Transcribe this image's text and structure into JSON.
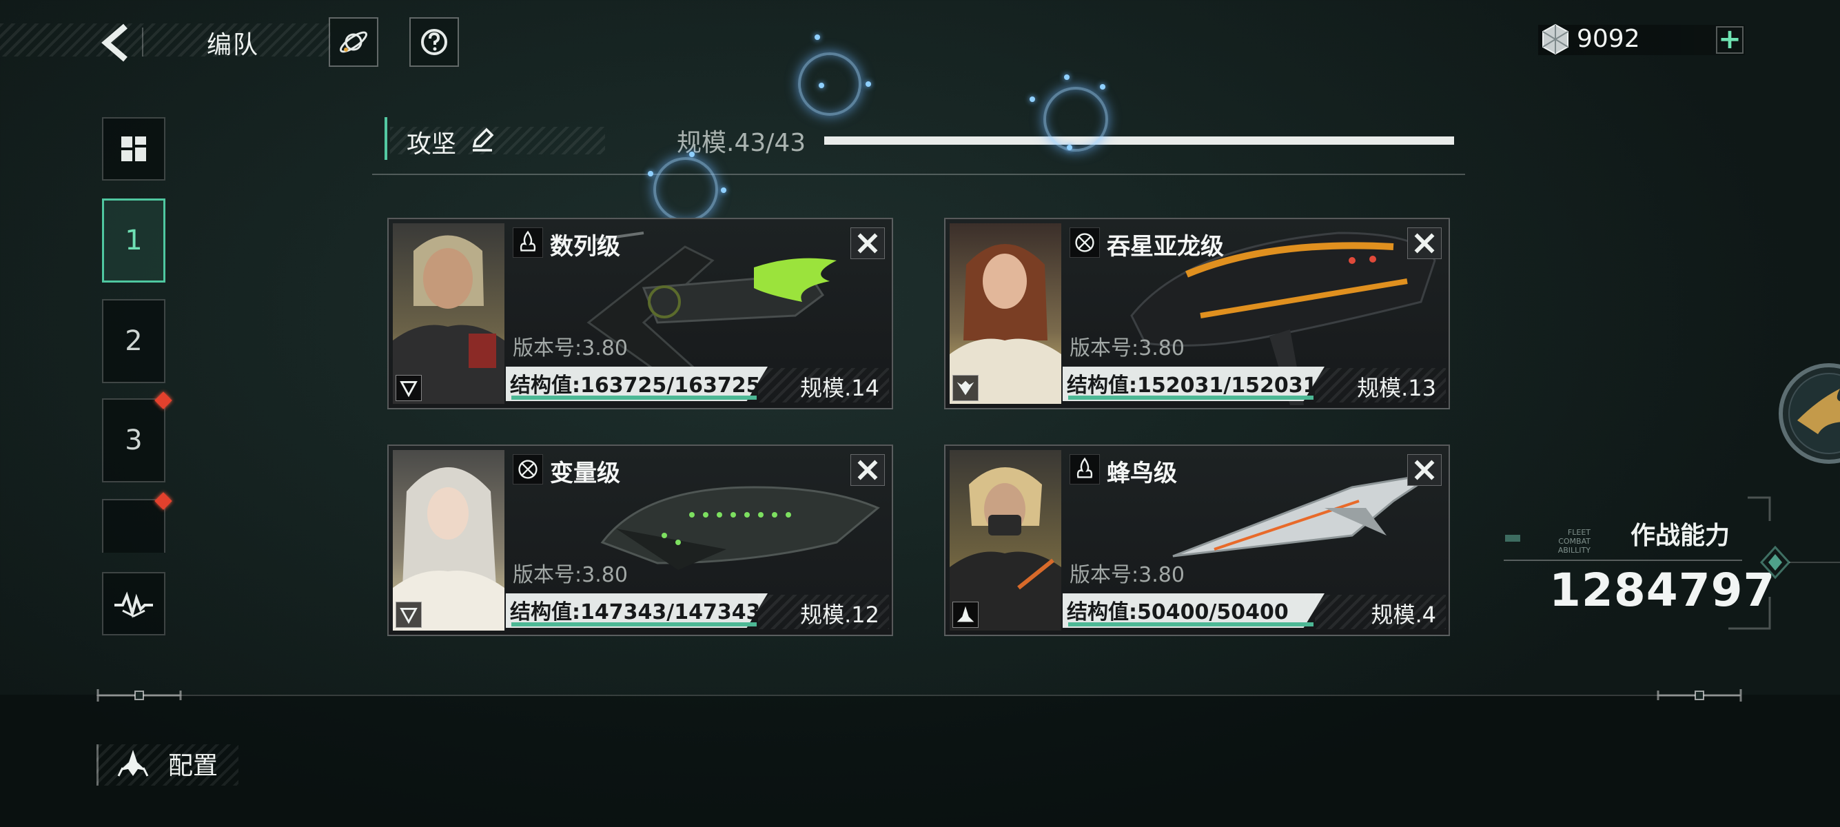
{
  "header": {
    "title": "编队",
    "back_icon": "chevron-left-icon",
    "buttons": [
      {
        "name": "planet-button",
        "icon": "planet-icon"
      },
      {
        "name": "help-button",
        "icon": "question-icon"
      }
    ]
  },
  "currency": {
    "icon": "crystal-gem-icon",
    "value": "9092",
    "add_label": "+"
  },
  "sidebar": {
    "tabs": [
      {
        "label": "1",
        "selected": true
      },
      {
        "label": "2",
        "selected": false
      },
      {
        "label": "3",
        "selected": false,
        "badge": true
      },
      {
        "label": "",
        "selected": false,
        "badge": true
      }
    ]
  },
  "squad": {
    "name": "攻坚",
    "scale_label": "规模.43/43",
    "scale_fraction": 1.0
  },
  "ships": [
    {
      "name": "数列级",
      "type_icon": "flame-icon",
      "class_icon": "triangle-down-icon",
      "version": "版本号:3.80",
      "structure": "结构值:163725/163725",
      "structure_fraction": 1.0,
      "scale": "规模.14",
      "accent": "#9be33c"
    },
    {
      "name": "吞星亚龙级",
      "type_icon": "crosshair-icon",
      "class_icon": "wing-emblem-icon",
      "version": "版本号:3.80",
      "structure": "结构值:152031/152031",
      "structure_fraction": 1.0,
      "scale": "规模.13",
      "accent": "#e0901f"
    },
    {
      "name": "变量级",
      "type_icon": "crosshair-icon",
      "class_icon": "triangle-down-icon",
      "version": "版本号:3.80",
      "structure": "结构值:147343/147343",
      "structure_fraction": 1.0,
      "scale": "规模.12",
      "accent": "#7de060"
    },
    {
      "name": "蜂鸟级",
      "type_icon": "flame-icon",
      "class_icon": "fighter-icon",
      "version": "版本号:3.80",
      "structure": "结构值:50400/50400",
      "structure_fraction": 1.0,
      "scale": "规模.4",
      "accent": "#e86a2a"
    }
  ],
  "combat_power": {
    "title": "作战能力",
    "subtitle_en": [
      "FLEET",
      "COMBAT ABILLITY"
    ],
    "value": "1284797"
  },
  "footer": {
    "config_label": "配置",
    "config_icon": "fleet-ships-icon"
  },
  "colors": {
    "accent": "#4fc7a0",
    "alert": "#e3412d",
    "background": "#172523"
  }
}
